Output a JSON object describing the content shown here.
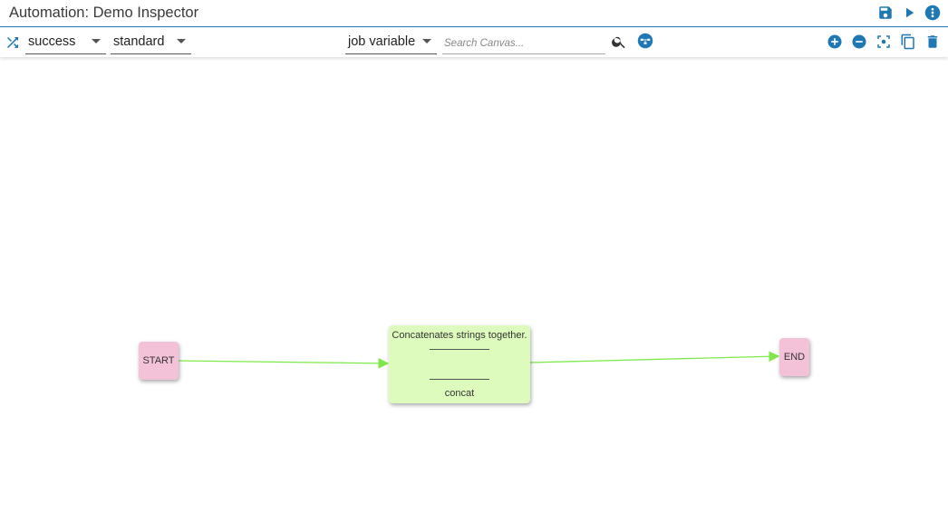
{
  "app": {
    "title": "Automation: Demo Inspector"
  },
  "title_actions": [
    {
      "icon": "save-icon"
    },
    {
      "icon": "play-icon"
    },
    {
      "icon": "more-vert-icon"
    }
  ],
  "toolbar": {
    "status_select": {
      "value": "success"
    },
    "type_select": {
      "value": "standard"
    },
    "variable_select": {
      "value": "job variable"
    },
    "search": {
      "placeholder": "Search Canvas...",
      "value": ""
    },
    "left_icon": "shuffle-icon",
    "search_icon": "search-icon",
    "layout_icon": "auto-layout-icon",
    "right_icons": [
      "zoom-in-icon",
      "zoom-out-icon",
      "fit-to-screen-icon",
      "copy-icon",
      "delete-icon"
    ]
  },
  "colors": {
    "accent": "#1f78b4",
    "terminal_node": "#f4c2d8",
    "task_node": "#ddfbbd",
    "edge": "#7de84a"
  },
  "canvas": {
    "start_node": {
      "label": "START"
    },
    "task_node": {
      "description": "Concatenates strings together.",
      "name": "concat"
    },
    "end_node": {
      "label": "END"
    }
  }
}
